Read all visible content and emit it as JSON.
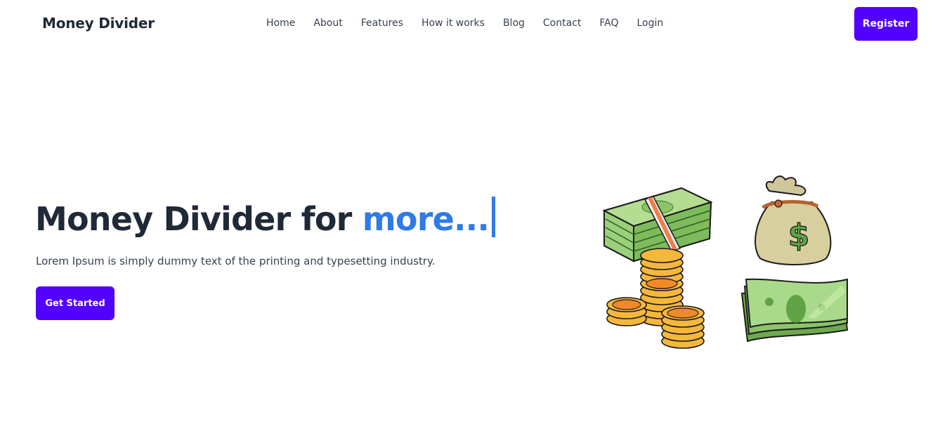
{
  "header": {
    "brand": "Money Divider",
    "nav": [
      "Home",
      "About",
      "Features",
      "How it works",
      "Blog",
      "Contact",
      "FAQ",
      "Login"
    ],
    "register_label": "Register"
  },
  "hero": {
    "title_main": "Money Divider for",
    "title_accent": "more...",
    "subtitle": "Lorem Ipsum is simply dummy text of the printing and typesetting industry.",
    "cta_label": "Get Started"
  },
  "colors": {
    "primary": "#5200ff",
    "accent": "#2f7be6",
    "text": "#1f2937"
  },
  "illustration": {
    "icons": [
      "cash-stack-icon",
      "money-bag-icon",
      "coin-stacks-icon",
      "banknotes-icon"
    ]
  }
}
